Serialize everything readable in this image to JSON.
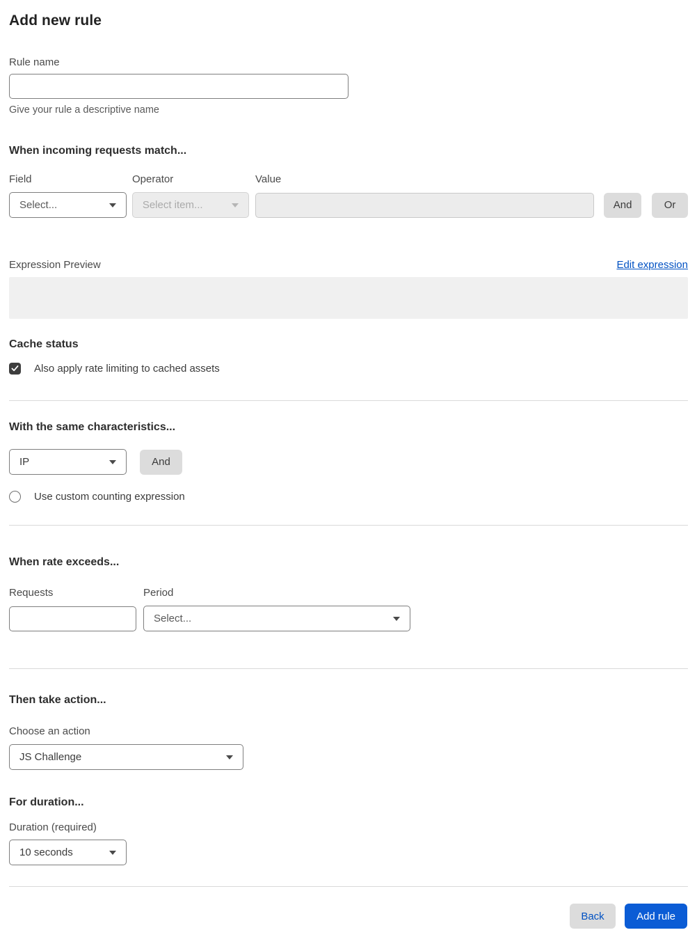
{
  "page": {
    "title": "Add new rule"
  },
  "rule_name": {
    "label": "Rule name",
    "value": "",
    "help": "Give your rule a descriptive name"
  },
  "match": {
    "heading": "When incoming requests match...",
    "field_label": "Field",
    "field_value": "Select...",
    "operator_label": "Operator",
    "operator_value": "Select item...",
    "value_label": "Value",
    "value_value": "",
    "and_label": "And",
    "or_label": "Or"
  },
  "expression": {
    "preview_label": "Expression Preview",
    "edit_link_label": "Edit expression",
    "preview_value": ""
  },
  "cache": {
    "heading": "Cache status",
    "checkbox_label": "Also apply rate limiting to cached assets",
    "checked": true
  },
  "characteristics": {
    "heading": "With the same characteristics...",
    "select_value": "IP",
    "and_label": "And",
    "custom_expression_label": "Use custom counting expression",
    "custom_expression_checked": false
  },
  "rate": {
    "heading": "When rate exceeds...",
    "requests_label": "Requests",
    "requests_value": "",
    "period_label": "Period",
    "period_value": "Select..."
  },
  "action": {
    "heading": "Then take action...",
    "choose_label": "Choose an action",
    "selected_value": "JS Challenge"
  },
  "duration": {
    "heading": "For duration...",
    "label": "Duration (required)",
    "selected_value": "10 seconds"
  },
  "footer": {
    "back_label": "Back",
    "submit_label": "Add rule"
  },
  "colors": {
    "primary_button": "#0b5cd5",
    "link_blue": "#0051c3",
    "disabled_bg": "#ececec",
    "preview_bg": "#f0f0f0",
    "checkbox_checked": "#3d3d3d",
    "divider": "#d9d9d9"
  }
}
